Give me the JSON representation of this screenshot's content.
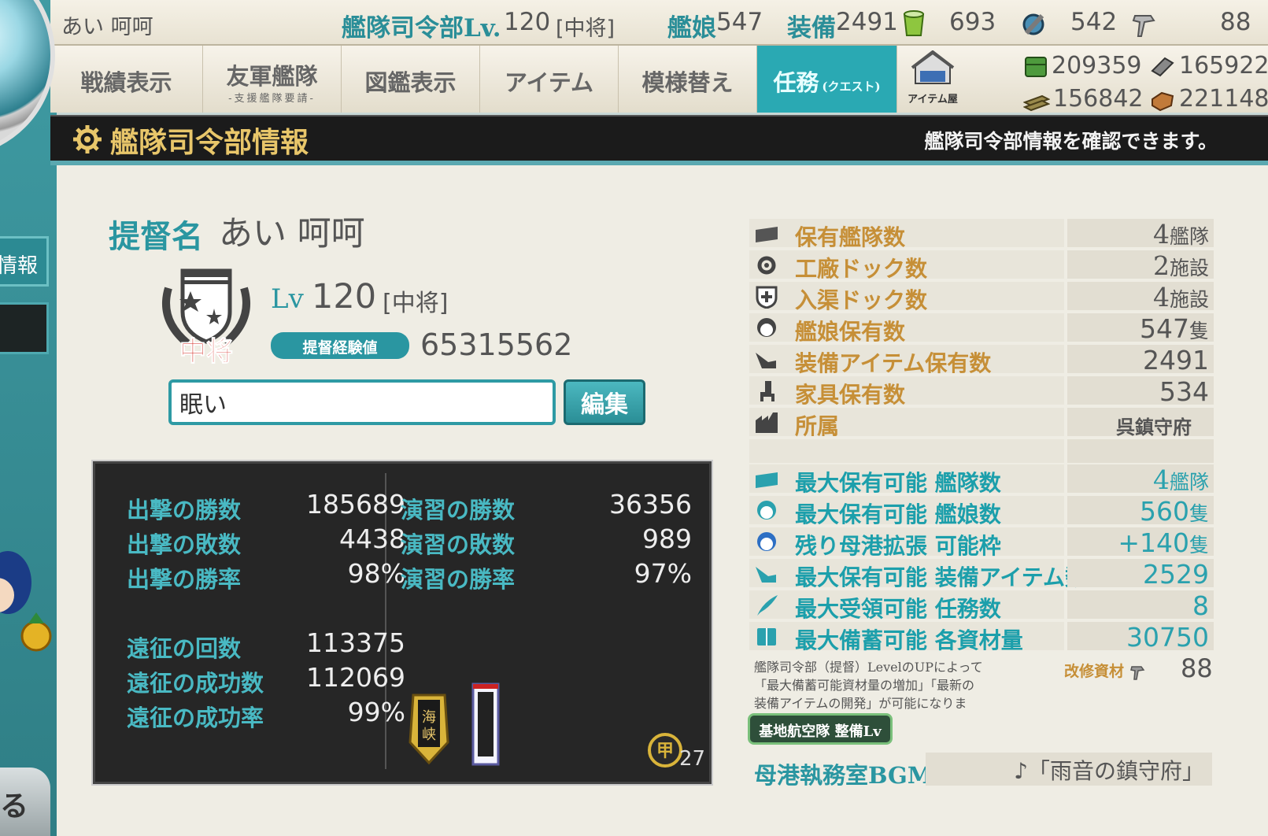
{
  "top_bar": {
    "admiral_name": "あい 呵呵",
    "hq_level_label": "艦隊司令部Lv.",
    "hq_level_value": "120",
    "hq_rank": "[中将]",
    "ships_label": "艦娘",
    "ships_value": "547",
    "equip_label": "装備",
    "equip_value": "2491",
    "bucket_value": "693",
    "devmat_value": "542",
    "screw_value": "88"
  },
  "menu": {
    "record": "戦績表示",
    "friend": "友軍艦隊",
    "friend_sub": "-支援艦隊要請-",
    "library": "図鑑表示",
    "item": "アイテム",
    "furniture": "模様替え",
    "quest": "任務",
    "quest_tag": "(クエスト)",
    "shop_label": "アイテム屋"
  },
  "resources": {
    "fuel": "209359",
    "ammo": "165922",
    "steel": "156842",
    "bauxite": "221148"
  },
  "rail": {
    "info_tab": "情報",
    "back_glyph": "る"
  },
  "section": {
    "title": "艦隊司令部情報",
    "description": "艦隊司令部情報を確認できます。"
  },
  "profile": {
    "name_label": "提督名",
    "name_value": "あい 呵呵",
    "rank_badge": "中将",
    "lv_label": "Lv",
    "lv_value": "120",
    "lv_rank": "[中将]",
    "exp_label": "提督経験値",
    "exp_value": "65315562",
    "comment_value": "眠い",
    "edit_label": "編集"
  },
  "stats": {
    "sortie_wins_label": "出撃の勝数",
    "sortie_wins": "185689",
    "sortie_losses_label": "出撃の敗数",
    "sortie_losses": "4438",
    "sortie_rate_label": "出撃の勝率",
    "sortie_rate": "98%",
    "exercise_wins_label": "演習の勝数",
    "exercise_wins": "36356",
    "exercise_losses_label": "演習の敗数",
    "exercise_losses": "989",
    "exercise_rate_label": "演習の勝率",
    "exercise_rate": "97%",
    "expedition_count_label": "遠征の回数",
    "expedition_count": "113375",
    "expedition_success_label": "遠征の成功数",
    "expedition_success": "112069",
    "expedition_rate_label": "遠征の成功率",
    "expedition_rate": "99%",
    "medal_count": "27"
  },
  "info": {
    "fleets_label": "保有艦隊数",
    "fleets_value": "4",
    "fleets_unit": "艦隊",
    "docks_label": "工廠ドック数",
    "docks_value": "2",
    "docks_unit": "施設",
    "repair_label": "入渠ドック数",
    "repair_value": "4",
    "repair_unit": "施設",
    "ships_label": "艦娘保有数",
    "ships_value": "547",
    "ships_unit": "隻",
    "equip_label": "装備アイテム保有数",
    "equip_value": "2491",
    "furniture_label": "家具保有数",
    "furniture_value": "534",
    "base_label": "所属",
    "base_value": "呉鎮守府",
    "max_fleets_label": "最大保有可能 艦隊数",
    "max_fleets_value": "4",
    "max_fleets_unit": "艦隊",
    "max_ships_label": "最大保有可能 艦娘数",
    "max_ships_value": "560",
    "max_ships_unit": "隻",
    "expand_label": "残り母港拡張 可能枠",
    "expand_value": "+140",
    "expand_unit": "隻",
    "max_equip_label": "最大保有可能 装備アイテム数",
    "max_equip_value": "2529",
    "max_quests_label": "最大受領可能 任務数",
    "max_quests_value": "8",
    "max_res_label": "最大備蓄可能 各資材量",
    "max_res_value": "30750"
  },
  "note": {
    "line1": "艦隊司令部（提督）LevelのUPによって",
    "line2": "「最大備蓄可能資材量の増加」「最新の",
    "line3": "装備アイテムの開発」が可能になります。",
    "kaishu_label": "改修資材",
    "kaishu_value": "88",
    "air_base_label": "基地航空隊 整備Lv"
  },
  "bgm": {
    "label": "母港執務室BGM",
    "value": "♪「雨音の鎮守府」"
  },
  "colors": {
    "accent_teal": "#2a96a1",
    "label_gold": "#c68f37",
    "header_gold": "#e8c66a"
  }
}
